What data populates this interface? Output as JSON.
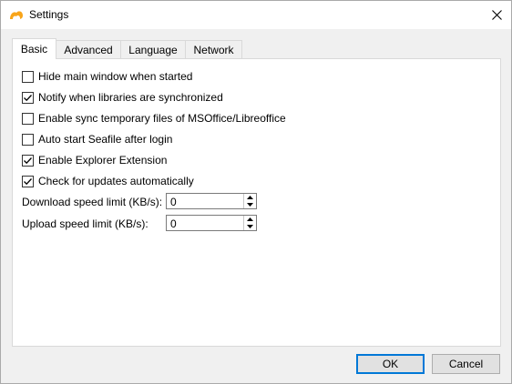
{
  "window": {
    "title": "Settings",
    "icon": "seafile-logo-icon",
    "accent_color": "#0078d7",
    "logo_color": "#f8a51b"
  },
  "tabs": [
    {
      "label": "Basic",
      "active": true
    },
    {
      "label": "Advanced",
      "active": false
    },
    {
      "label": "Language",
      "active": false
    },
    {
      "label": "Network",
      "active": false
    }
  ],
  "basic": {
    "checkboxes": [
      {
        "label": "Hide main window when started",
        "checked": false
      },
      {
        "label": "Notify when libraries are synchronized",
        "checked": true
      },
      {
        "label": "Enable sync temporary files of MSOffice/Libreoffice",
        "checked": false
      },
      {
        "label": "Auto start Seafile after login",
        "checked": false
      },
      {
        "label": "Enable Explorer Extension",
        "checked": true
      },
      {
        "label": "Check for updates automatically",
        "checked": true
      }
    ],
    "download_limit": {
      "label": "Download speed limit (KB/s):",
      "value": "0"
    },
    "upload_limit": {
      "label": "Upload speed limit (KB/s):",
      "value": "0"
    }
  },
  "buttons": {
    "ok": "OK",
    "cancel": "Cancel"
  }
}
